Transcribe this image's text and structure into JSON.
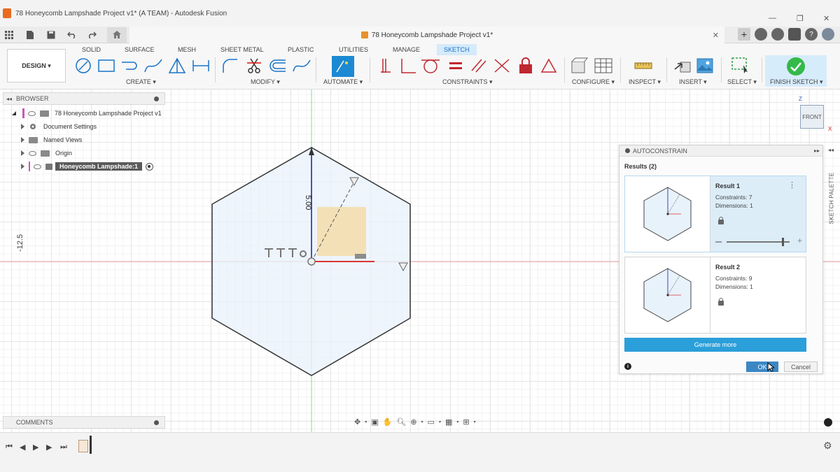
{
  "window": {
    "title": "78 Honeycomb Lampshade Project v1* (A TEAM) - Autodesk Fusion",
    "minimize_glyph": "—",
    "maximize_glyph": "❐",
    "close_glyph": "✕"
  },
  "document": {
    "tab_title": "78 Honeycomb Lampshade Project v1*",
    "close_glyph": "✕",
    "new_tab_glyph": "+"
  },
  "ribbon": {
    "workspace_button": "DESIGN ▾",
    "tabs": [
      "SOLID",
      "SURFACE",
      "MESH",
      "SHEET METAL",
      "PLASTIC",
      "UTILITIES",
      "MANAGE",
      "SKETCH"
    ],
    "active_tab": "SKETCH",
    "groups": [
      "CREATE ▾",
      "MODIFY ▾",
      "AUTOMATE ▾",
      "CONSTRAINTS ▾",
      "CONFIGURE ▾",
      "INSPECT ▾",
      "INSERT ▾",
      "SELECT ▾",
      "FINISH SKETCH ▾"
    ]
  },
  "browser": {
    "header": "BROWSER",
    "items": [
      {
        "label": "78 Honeycomb Lampshade Project v1"
      },
      {
        "label": "Document Settings"
      },
      {
        "label": "Named Views"
      },
      {
        "label": "Origin"
      },
      {
        "label": "Honeycomb Lampshade:1"
      }
    ]
  },
  "comments": {
    "header": "COMMENTS"
  },
  "canvas": {
    "dimension_label": "5.00",
    "axis_label": "-12.5",
    "viewcube_face": "FRONT",
    "axis_z": "Z",
    "axis_x": "X"
  },
  "autoconstrain": {
    "header": "AUTOCONSTRAIN",
    "results_label": "Results (2)",
    "results": [
      {
        "title": "Result 1",
        "constraints": "Constraints: 7",
        "dimensions": "Dimensions: 1"
      },
      {
        "title": "Result 2",
        "constraints": "Constraints: 9",
        "dimensions": "Dimensions: 1"
      }
    ],
    "generate_more": "Generate more",
    "ok": "OK",
    "cancel": "Cancel",
    "slider_value": 0.9
  },
  "sketch_palette_label": "SKETCH PALETTE",
  "colors": {
    "accent": "#1a73c7",
    "finish_green": "#35b94a",
    "generate_blue": "#2b9fd9",
    "sketch_fill": "#e8f2fb"
  }
}
